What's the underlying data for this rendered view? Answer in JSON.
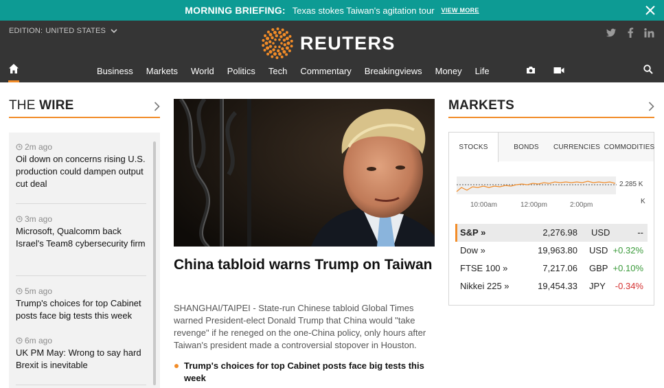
{
  "briefing": {
    "label": "MORNING BRIEFING:",
    "text": "Texas stokes Taiwan's agitation tour",
    "more": "VIEW MORE"
  },
  "header": {
    "edition_prefix": "EDITION:",
    "edition": "UNITED STATES",
    "logo_word": "REUTERS",
    "social": [
      "twitter-icon",
      "facebook-icon",
      "linkedin-icon"
    ]
  },
  "nav": {
    "items": [
      "Business",
      "Markets",
      "World",
      "Politics",
      "Tech",
      "Commentary",
      "Breakingviews",
      "Money",
      "Life"
    ]
  },
  "wire": {
    "title_thin": "THE",
    "title_bold": "WIRE",
    "items": [
      {
        "time": "2m ago",
        "headline": "Oil down on concerns rising U.S. production could dampen output cut deal"
      },
      {
        "time": "3m ago",
        "headline": "Microsoft, Qualcomm back Israel's Team8 cybersecurity firm"
      },
      {
        "time": "5m ago",
        "headline": "Trump's choices for top Cabinet posts face big tests this week"
      },
      {
        "time": "6m ago",
        "headline": "UK PM May: Wrong to say hard Brexit is inevitable"
      }
    ]
  },
  "main": {
    "title": "China tabloid warns Trump on Taiwan",
    "body": "SHANGHAI/TAIPEI - State-run Chinese tabloid Global Times warned President-elect Donald Trump that China would \"take revenge\" if he reneged on the one-China policy, only hours after Taiwan's president made a controversial stopover in Houston.",
    "bullet": "Trump's choices for top Cabinet posts face big tests this week"
  },
  "markets": {
    "title": "MARKETS",
    "tabs": [
      "STOCKS",
      "BONDS",
      "CURRENCIES",
      "COMMODITIES"
    ],
    "active_tab": "STOCKS",
    "chart": {
      "value_label": "2.285 K",
      "unit_label": "K",
      "times": [
        "10:00am",
        "12:00pm",
        "2:00pm"
      ]
    },
    "quotes": [
      {
        "name": "S&P »",
        "value": "2,276.98",
        "currency": "USD",
        "change": "--",
        "dir": "flat"
      },
      {
        "name": "Dow »",
        "value": "19,963.80",
        "currency": "USD",
        "change": "+0.32%",
        "dir": "up"
      },
      {
        "name": "FTSE 100 »",
        "value": "7,217.06",
        "currency": "GBP",
        "change": "+0.10%",
        "dir": "up"
      },
      {
        "name": "Nikkei 225 »",
        "value": "19,454.33",
        "currency": "JPY",
        "change": "-0.34%",
        "dir": "down"
      }
    ]
  },
  "colors": {
    "accent": "#f28c28",
    "briefing_bg": "#0d9b94",
    "header_bg": "#353535",
    "positive": "#3a9a3a",
    "negative": "#d43030"
  }
}
